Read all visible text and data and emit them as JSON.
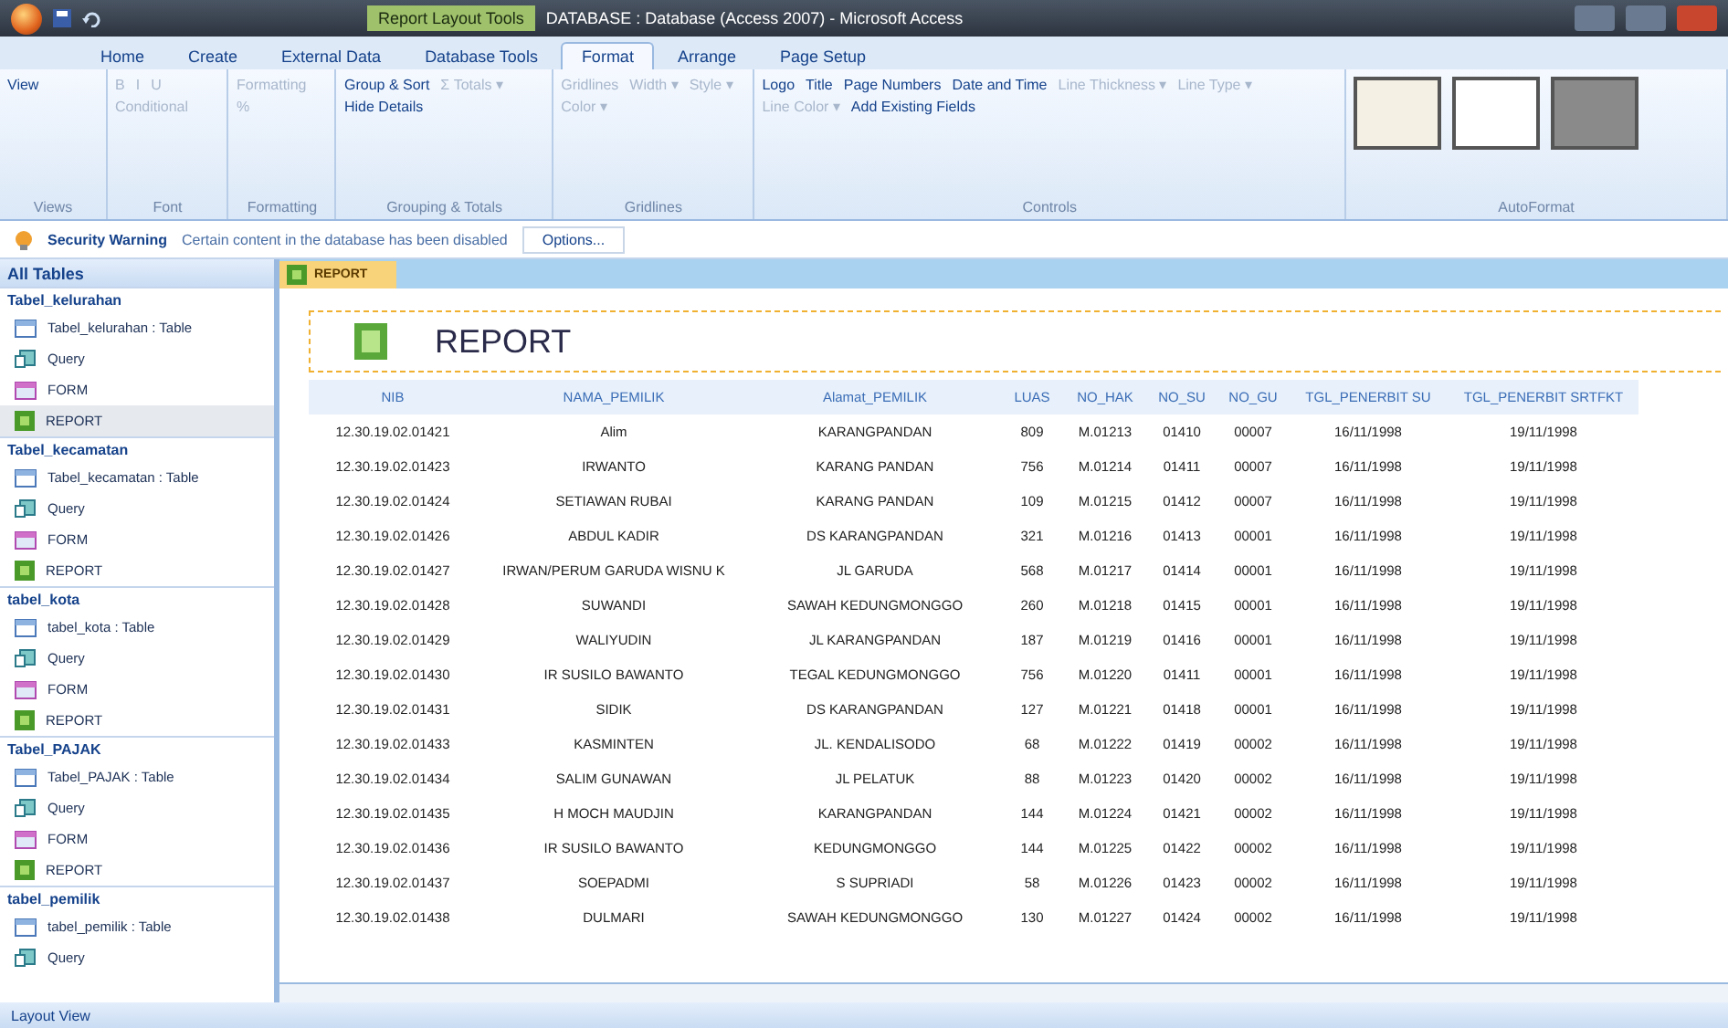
{
  "window": {
    "context_tab": "Report Layout Tools",
    "title": "DATABASE : Database (Access 2007) - Microsoft Access"
  },
  "ribbon_tabs": [
    {
      "label": "Home",
      "selected": false
    },
    {
      "label": "Create",
      "selected": false
    },
    {
      "label": "External Data",
      "selected": false
    },
    {
      "label": "Database Tools",
      "selected": false
    },
    {
      "label": "Format",
      "selected": true
    },
    {
      "label": "Arrange",
      "selected": false
    },
    {
      "label": "Page Setup",
      "selected": false
    }
  ],
  "ribbon_groups": [
    {
      "label": "Views",
      "items": [
        {
          "label": "View",
          "disabled": false
        }
      ]
    },
    {
      "label": "Font",
      "items": [
        {
          "label": "B",
          "disabled": true
        },
        {
          "label": "I",
          "disabled": true
        },
        {
          "label": "U",
          "disabled": true
        },
        {
          "label": "Conditional",
          "disabled": true
        }
      ]
    },
    {
      "label": "Formatting",
      "items": [
        {
          "label": "Formatting",
          "disabled": true
        },
        {
          "label": "%",
          "disabled": true
        }
      ]
    },
    {
      "label": "Grouping & Totals",
      "items": [
        {
          "label": "Group & Sort",
          "disabled": false
        },
        {
          "label": "Σ Totals ▾",
          "disabled": true
        },
        {
          "label": "Hide Details",
          "disabled": false
        }
      ]
    },
    {
      "label": "Gridlines",
      "items": [
        {
          "label": "Gridlines",
          "disabled": true
        },
        {
          "label": "Width ▾",
          "disabled": true
        },
        {
          "label": "Style ▾",
          "disabled": true
        },
        {
          "label": "Color ▾",
          "disabled": true
        }
      ]
    },
    {
      "label": "Controls",
      "items": [
        {
          "label": "Logo",
          "disabled": false
        },
        {
          "label": "Title",
          "disabled": false
        },
        {
          "label": "Page Numbers",
          "disabled": false
        },
        {
          "label": "Date and Time",
          "disabled": false
        },
        {
          "label": "Line Thickness ▾",
          "disabled": true
        },
        {
          "label": "Line Type ▾",
          "disabled": true
        },
        {
          "label": "Line Color ▾",
          "disabled": true
        },
        {
          "label": "Add Existing Fields",
          "disabled": false
        }
      ]
    },
    {
      "label": "AutoFormat"
    }
  ],
  "security_bar": {
    "title": "Security Warning",
    "message": "Certain content in the database has been disabled",
    "button": "Options..."
  },
  "nav_pane": {
    "title": "All Tables",
    "groups": [
      {
        "name": "Tabel_kelurahan",
        "items": [
          {
            "kind": "table",
            "label": "Tabel_kelurahan : Table",
            "selected": false
          },
          {
            "kind": "query",
            "label": "Query",
            "selected": false
          },
          {
            "kind": "form",
            "label": "FORM",
            "selected": false
          },
          {
            "kind": "report",
            "label": "REPORT",
            "selected": true
          }
        ]
      },
      {
        "name": "Tabel_kecamatan",
        "items": [
          {
            "kind": "table",
            "label": "Tabel_kecamatan : Table",
            "selected": false
          },
          {
            "kind": "query",
            "label": "Query",
            "selected": false
          },
          {
            "kind": "form",
            "label": "FORM",
            "selected": false
          },
          {
            "kind": "report",
            "label": "REPORT",
            "selected": false
          }
        ]
      },
      {
        "name": "tabel_kota",
        "items": [
          {
            "kind": "table",
            "label": "tabel_kota : Table",
            "selected": false
          },
          {
            "kind": "query",
            "label": "Query",
            "selected": false
          },
          {
            "kind": "form",
            "label": "FORM",
            "selected": false
          },
          {
            "kind": "report",
            "label": "REPORT",
            "selected": false
          }
        ]
      },
      {
        "name": "Tabel_PAJAK",
        "items": [
          {
            "kind": "table",
            "label": "Tabel_PAJAK : Table",
            "selected": false
          },
          {
            "kind": "query",
            "label": "Query",
            "selected": false
          },
          {
            "kind": "form",
            "label": "FORM",
            "selected": false
          },
          {
            "kind": "report",
            "label": "REPORT",
            "selected": false
          }
        ]
      },
      {
        "name": "tabel_pemilik",
        "items": [
          {
            "kind": "table",
            "label": "tabel_pemilik : Table",
            "selected": false
          },
          {
            "kind": "query",
            "label": "Query",
            "selected": false
          }
        ]
      }
    ]
  },
  "document_tab": "REPORT",
  "report": {
    "title": "REPORT",
    "columns": [
      "NIB",
      "NAMA_PEMILIK",
      "Alamat_PEMILIK",
      "LUAS",
      "NO_HAK",
      "NO_SU",
      "NO_GU",
      "TGL_PENERBIT SU",
      "TGL_PENERBIT SRTFKT"
    ],
    "rows": [
      [
        "12.30.19.02.01421",
        "Alim",
        "KARANGPANDAN",
        "809",
        "M.01213",
        "01410",
        "00007",
        "16/11/1998",
        "19/11/1998"
      ],
      [
        "12.30.19.02.01423",
        "IRWANTO",
        "KARANG PANDAN",
        "756",
        "M.01214",
        "01411",
        "00007",
        "16/11/1998",
        "19/11/1998"
      ],
      [
        "12.30.19.02.01424",
        "SETIAWAN RUBAI",
        "KARANG PANDAN",
        "109",
        "M.01215",
        "01412",
        "00007",
        "16/11/1998",
        "19/11/1998"
      ],
      [
        "12.30.19.02.01426",
        "ABDUL KADIR",
        "DS KARANGPANDAN",
        "321",
        "M.01216",
        "01413",
        "00001",
        "16/11/1998",
        "19/11/1998"
      ],
      [
        "12.30.19.02.01427",
        "IRWAN/PERUM GARUDA WISNU K",
        "JL GARUDA",
        "568",
        "M.01217",
        "01414",
        "00001",
        "16/11/1998",
        "19/11/1998"
      ],
      [
        "12.30.19.02.01428",
        "SUWANDI",
        "SAWAH KEDUNGMONGGO",
        "260",
        "M.01218",
        "01415",
        "00001",
        "16/11/1998",
        "19/11/1998"
      ],
      [
        "12.30.19.02.01429",
        "WALIYUDIN",
        "JL KARANGPANDAN",
        "187",
        "M.01219",
        "01416",
        "00001",
        "16/11/1998",
        "19/11/1998"
      ],
      [
        "12.30.19.02.01430",
        "IR SUSILO BAWANTO",
        "TEGAL KEDUNGMONGGO",
        "756",
        "M.01220",
        "01411",
        "00001",
        "16/11/1998",
        "19/11/1998"
      ],
      [
        "12.30.19.02.01431",
        "SIDIK",
        "DS KARANGPANDAN",
        "127",
        "M.01221",
        "01418",
        "00001",
        "16/11/1998",
        "19/11/1998"
      ],
      [
        "12.30.19.02.01433",
        "KASMINTEN",
        "JL. KENDALISODO",
        "68",
        "M.01222",
        "01419",
        "00002",
        "16/11/1998",
        "19/11/1998"
      ],
      [
        "12.30.19.02.01434",
        "SALIM GUNAWAN",
        "JL PELATUK",
        "88",
        "M.01223",
        "01420",
        "00002",
        "16/11/1998",
        "19/11/1998"
      ],
      [
        "12.30.19.02.01435",
        "H MOCH MAUDJIN",
        "KARANGPANDAN",
        "144",
        "M.01224",
        "01421",
        "00002",
        "16/11/1998",
        "19/11/1998"
      ],
      [
        "12.30.19.02.01436",
        "IR SUSILO BAWANTO",
        "KEDUNGMONGGO",
        "144",
        "M.01225",
        "01422",
        "00002",
        "16/11/1998",
        "19/11/1998"
      ],
      [
        "12.30.19.02.01437",
        "SOEPADMI",
        "S SUPRIADI",
        "58",
        "M.01226",
        "01423",
        "00002",
        "16/11/1998",
        "19/11/1998"
      ],
      [
        "12.30.19.02.01438",
        "DULMARI",
        "SAWAH KEDUNGMONGGO",
        "130",
        "M.01227",
        "01424",
        "00002",
        "16/11/1998",
        "19/11/1998"
      ]
    ]
  },
  "status_bar": {
    "text": "Layout View"
  }
}
